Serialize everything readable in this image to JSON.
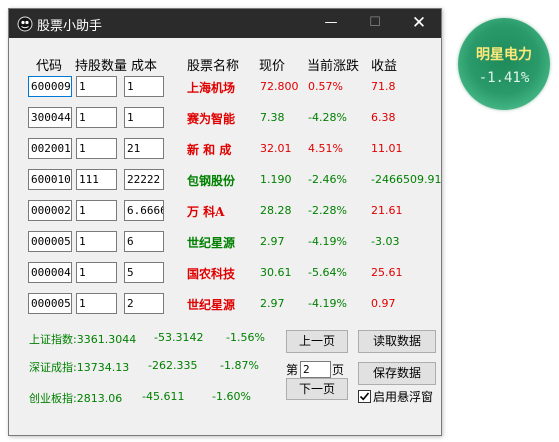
{
  "window": {
    "title": "股票小助手",
    "minimize": "—",
    "maximize": "☐",
    "close": "✕"
  },
  "headers": {
    "code": "代码",
    "qty": "持股数量",
    "cost": "成本",
    "name": "股票名称",
    "price": "现价",
    "change": "当前涨跌",
    "profit": "收益"
  },
  "rows": [
    {
      "code": "600009",
      "qty": "1",
      "cost": "1",
      "name": "上海机场",
      "price": "72.800",
      "change": "0.57%",
      "profit": "71.8",
      "dir": "up"
    },
    {
      "code": "300044",
      "qty": "1",
      "cost": "1",
      "name": "赛为智能",
      "price": "7.38",
      "change": "-4.28%",
      "profit": "6.38",
      "dir": "down"
    },
    {
      "code": "002001",
      "qty": "1",
      "cost": "21",
      "name": "新 和 成",
      "price": "32.01",
      "change": "4.51%",
      "profit": "11.01",
      "dir": "up"
    },
    {
      "code": "600010",
      "qty": "111",
      "cost": "22222",
      "name": "包钢股份",
      "price": "1.190",
      "change": "-2.46%",
      "profit": "-2466509.91",
      "dir": "down"
    },
    {
      "code": "000002",
      "qty": "1",
      "cost": "6.6666",
      "name": "万 科A",
      "price": "28.28",
      "change": "-2.28%",
      "profit": "21.61",
      "dir": "down"
    },
    {
      "code": "000005",
      "qty": "1",
      "cost": "6",
      "name": "世纪星源",
      "price": "2.97",
      "change": "-4.19%",
      "profit": "-3.03",
      "dir": "down"
    },
    {
      "code": "000004",
      "qty": "1",
      "cost": "5",
      "name": "国农科技",
      "price": "30.61",
      "change": "-5.64%",
      "profit": "25.61",
      "dir": "down"
    },
    {
      "code": "000005",
      "qty": "1",
      "cost": "2",
      "name": "世纪星源",
      "price": "2.97",
      "change": "-4.19%",
      "profit": "0.97",
      "dir": "down"
    }
  ],
  "row_colors": {
    "names": [
      "up",
      "up",
      "up",
      "down",
      "up",
      "down",
      "up",
      "up"
    ],
    "prices": [
      "up",
      "down",
      "up",
      "down",
      "down",
      "down",
      "down",
      "down"
    ],
    "changes": [
      "up",
      "down",
      "up",
      "down",
      "down",
      "down",
      "down",
      "down"
    ],
    "profits": [
      "up",
      "up",
      "up",
      "down",
      "up",
      "down",
      "up",
      "up"
    ]
  },
  "indices": [
    {
      "label": "上证指数:3361.3044",
      "change": "-53.3142",
      "pct": "-1.56%"
    },
    {
      "label": "深证成指:13734.13",
      "change": "-262.335",
      "pct": "-1.87%"
    },
    {
      "label": "创业板指:2813.06",
      "change": "-45.611",
      "pct": "-1.60%"
    }
  ],
  "controls": {
    "prev": "上一页",
    "next": "下一页",
    "read": "读取数据",
    "save": "保存数据",
    "page_prefix": "第",
    "page_value": "2",
    "page_suffix": "页",
    "float_label": "启用悬浮窗",
    "float_checked": true
  },
  "widget": {
    "name": "明星电力",
    "change": "-1.41%"
  },
  "colors": {
    "up": "#e00000",
    "down": "#008000",
    "titlebar": "#2b2b2b",
    "widget": "#2a9a6a",
    "widget_name": "#ffe97a"
  }
}
